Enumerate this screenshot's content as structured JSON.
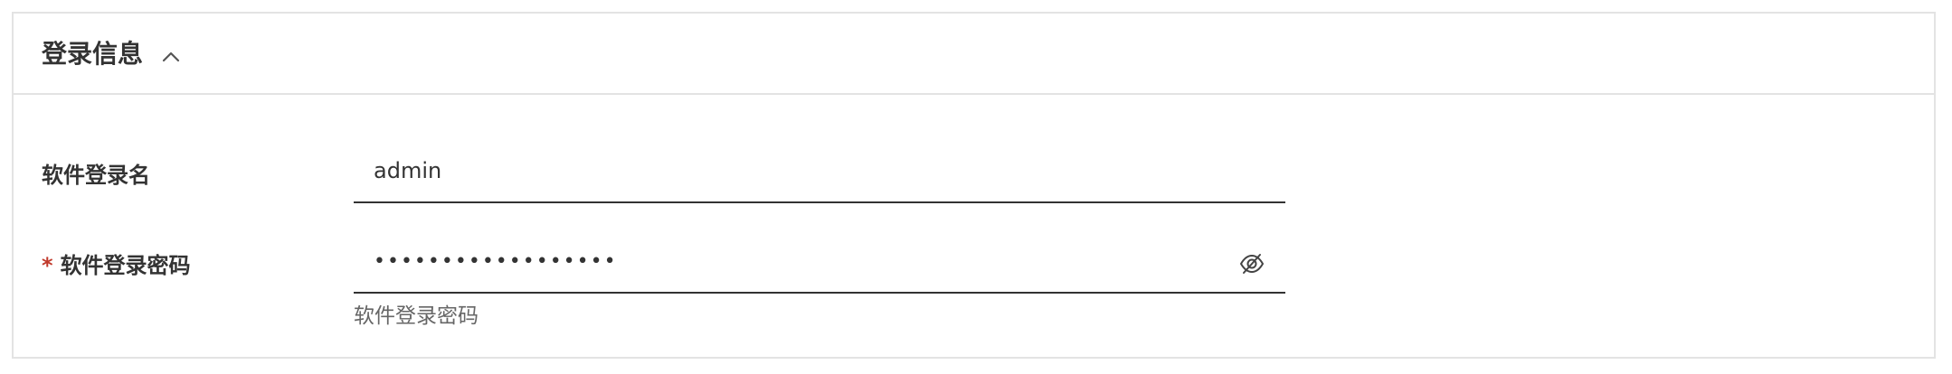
{
  "section": {
    "title": "登录信息",
    "collapse_icon": "chevron-up-icon"
  },
  "fields": {
    "username": {
      "label": "软件登录名",
      "value": "admin"
    },
    "password": {
      "required_mark": "*",
      "label": "软件登录密码",
      "masked_value": "••••••••••••••••••",
      "visibility_icon": "eye-off-icon",
      "helper": "软件登录密码"
    }
  }
}
